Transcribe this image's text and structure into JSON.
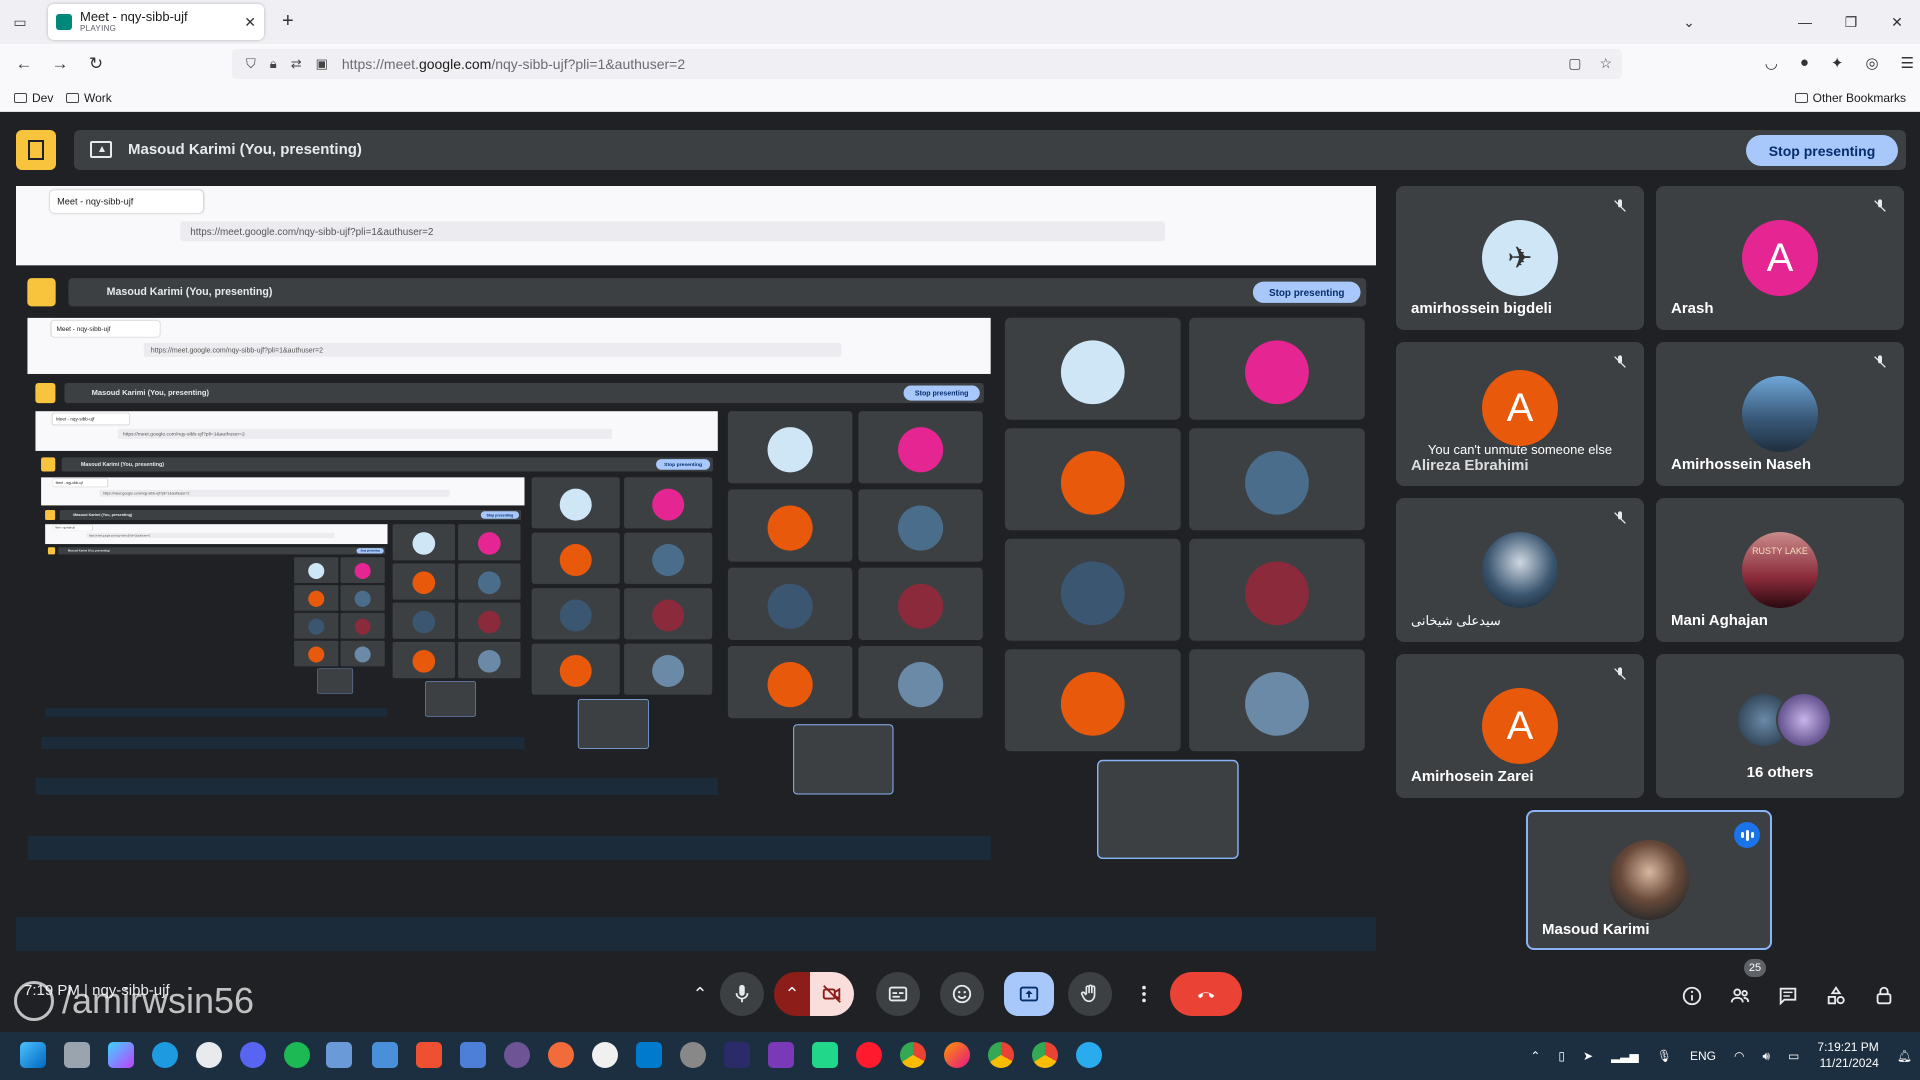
{
  "browser": {
    "tab_title": "Meet - nqy-sibb-ujf",
    "tab_status": "PLAYING",
    "url_prefix": "https://meet.",
    "url_domain": "google.com",
    "url_path": "/nqy-sibb-ujf?pli=1&authuser=2",
    "bookmarks": [
      "Dev",
      "Work"
    ],
    "other_bookmarks": "Other Bookmarks"
  },
  "presenting_bar": {
    "label": "Masoud Karimi (You, presenting)",
    "stop_label": "Stop presenting"
  },
  "participants": [
    {
      "name": "amirhossein bigdeli",
      "avatar_color": "#cfe6f7",
      "muted": true
    },
    {
      "name": "Arash",
      "initial": "A",
      "avatar_color": "#e52592",
      "muted": true
    },
    {
      "name": "Alireza Ebrahimi",
      "initial": "A",
      "avatar_color": "#e8590c",
      "muted": true,
      "tooltip": "You can't unmute someone else"
    },
    {
      "name": "Amirhossein Naseh",
      "avatar_color": "#4a6d8c",
      "muted": true
    },
    {
      "name": "سیدعلی شیخانی",
      "avatar_color": "#203040",
      "muted": true
    },
    {
      "name": "Mani Aghajan",
      "avatar_color": "#8a2a3a",
      "muted": false,
      "avatar_text": "RUSTY LAKE"
    },
    {
      "name": "Amirhosein Zarei",
      "initial": "A",
      "avatar_color": "#e8590c",
      "muted": true
    }
  ],
  "others": {
    "label": "16 others"
  },
  "self": {
    "name": "Masoud Karimi"
  },
  "meeting": {
    "time": "7:19 PM",
    "code": "nqy-sibb-ujf",
    "participant_count": "25"
  },
  "watermark": "/amirwsin56",
  "taskbar": {
    "language": "ENG",
    "time": "7:19:21 PM",
    "date": "11/21/2024"
  },
  "colors": {
    "meet_bg": "#202124",
    "tile_bg": "#3c4043",
    "accent": "#a8c7fa",
    "end_call": "#ea4335",
    "present_active": "#8ab4f8",
    "camera_off": "#8c1d18"
  }
}
